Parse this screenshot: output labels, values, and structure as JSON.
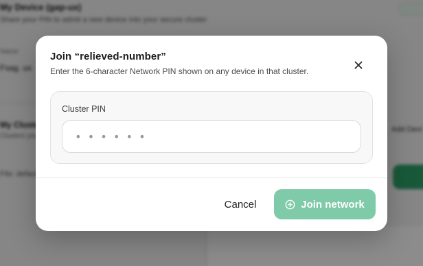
{
  "background": {
    "device_title": "My Device (gap-ux)",
    "device_sub": "Share your PIN to admit a new device into your secure cluster",
    "field_label": "Name",
    "field_value": "Fsag. ux",
    "section_title": "My Clusters",
    "section_sub": "Clusters you are a member of",
    "add_label": "Add Devi",
    "status_text": "Fits: default"
  },
  "dialog": {
    "title": "Join “relieved-number”",
    "description": "Enter the 6-character Network PIN shown on any device in that cluster.",
    "close_icon": "close-icon",
    "pin_label": "Cluster PIN",
    "pin_value": "",
    "pin_placeholder": "••••••",
    "cancel_label": "Cancel",
    "join_label": "Join network",
    "join_icon": "plus-circle-icon"
  },
  "colors": {
    "accent": "#7fcaa8",
    "overlay": "rgba(0,0,0,0.45)"
  }
}
